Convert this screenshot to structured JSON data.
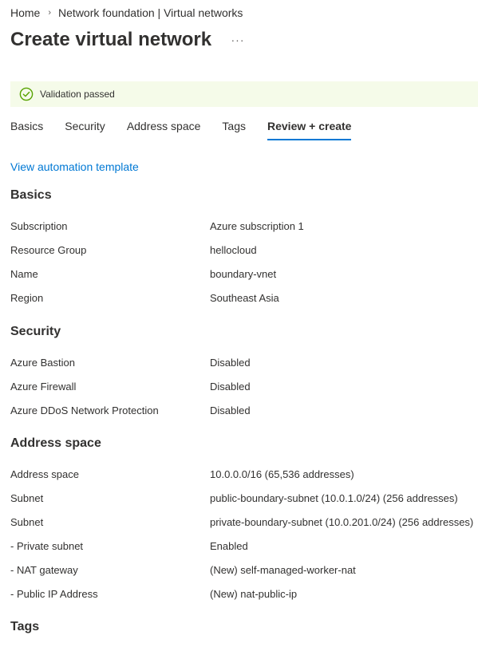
{
  "breadcrumb": {
    "items": [
      "Home",
      "Network foundation | Virtual networks"
    ]
  },
  "page": {
    "title": "Create virtual network",
    "more_label": "···"
  },
  "banner": {
    "text": "Validation passed",
    "accent_color": "#57a300",
    "background": "#f5fbe9"
  },
  "tabs": [
    {
      "label": "Basics",
      "active": false
    },
    {
      "label": "Security",
      "active": false
    },
    {
      "label": "Address space",
      "active": false
    },
    {
      "label": "Tags",
      "active": false
    },
    {
      "label": "Review + create",
      "active": true
    }
  ],
  "links": {
    "automation": "View automation template"
  },
  "sections": {
    "basics": {
      "heading": "Basics",
      "rows": [
        {
          "label": "Subscription",
          "value": "Azure subscription 1"
        },
        {
          "label": "Resource Group",
          "value": "hellocloud"
        },
        {
          "label": "Name",
          "value": "boundary-vnet"
        },
        {
          "label": "Region",
          "value": "Southeast Asia"
        }
      ]
    },
    "security": {
      "heading": "Security",
      "rows": [
        {
          "label": "Azure Bastion",
          "value": "Disabled"
        },
        {
          "label": "Azure Firewall",
          "value": "Disabled"
        },
        {
          "label": "Azure DDoS Network Protection",
          "value": "Disabled"
        }
      ]
    },
    "address_space": {
      "heading": "Address space",
      "rows": [
        {
          "label": "Address space",
          "value": "10.0.0.0/16 (65,536 addresses)"
        },
        {
          "label": "Subnet",
          "value": "public-boundary-subnet (10.0.1.0/24) (256 addresses)"
        },
        {
          "label": "Subnet",
          "value": "private-boundary-subnet (10.0.201.0/24) (256 addresses)"
        },
        {
          "label": "- Private subnet",
          "value": "Enabled"
        },
        {
          "label": "- NAT gateway",
          "value": "(New) self-managed-worker-nat"
        },
        {
          "label": "- Public IP Address",
          "value": "(New) nat-public-ip"
        }
      ]
    },
    "tags": {
      "heading": "Tags"
    }
  },
  "colors": {
    "link": "#0078d4",
    "tab_underline": "#0078d4",
    "text": "#323130"
  }
}
